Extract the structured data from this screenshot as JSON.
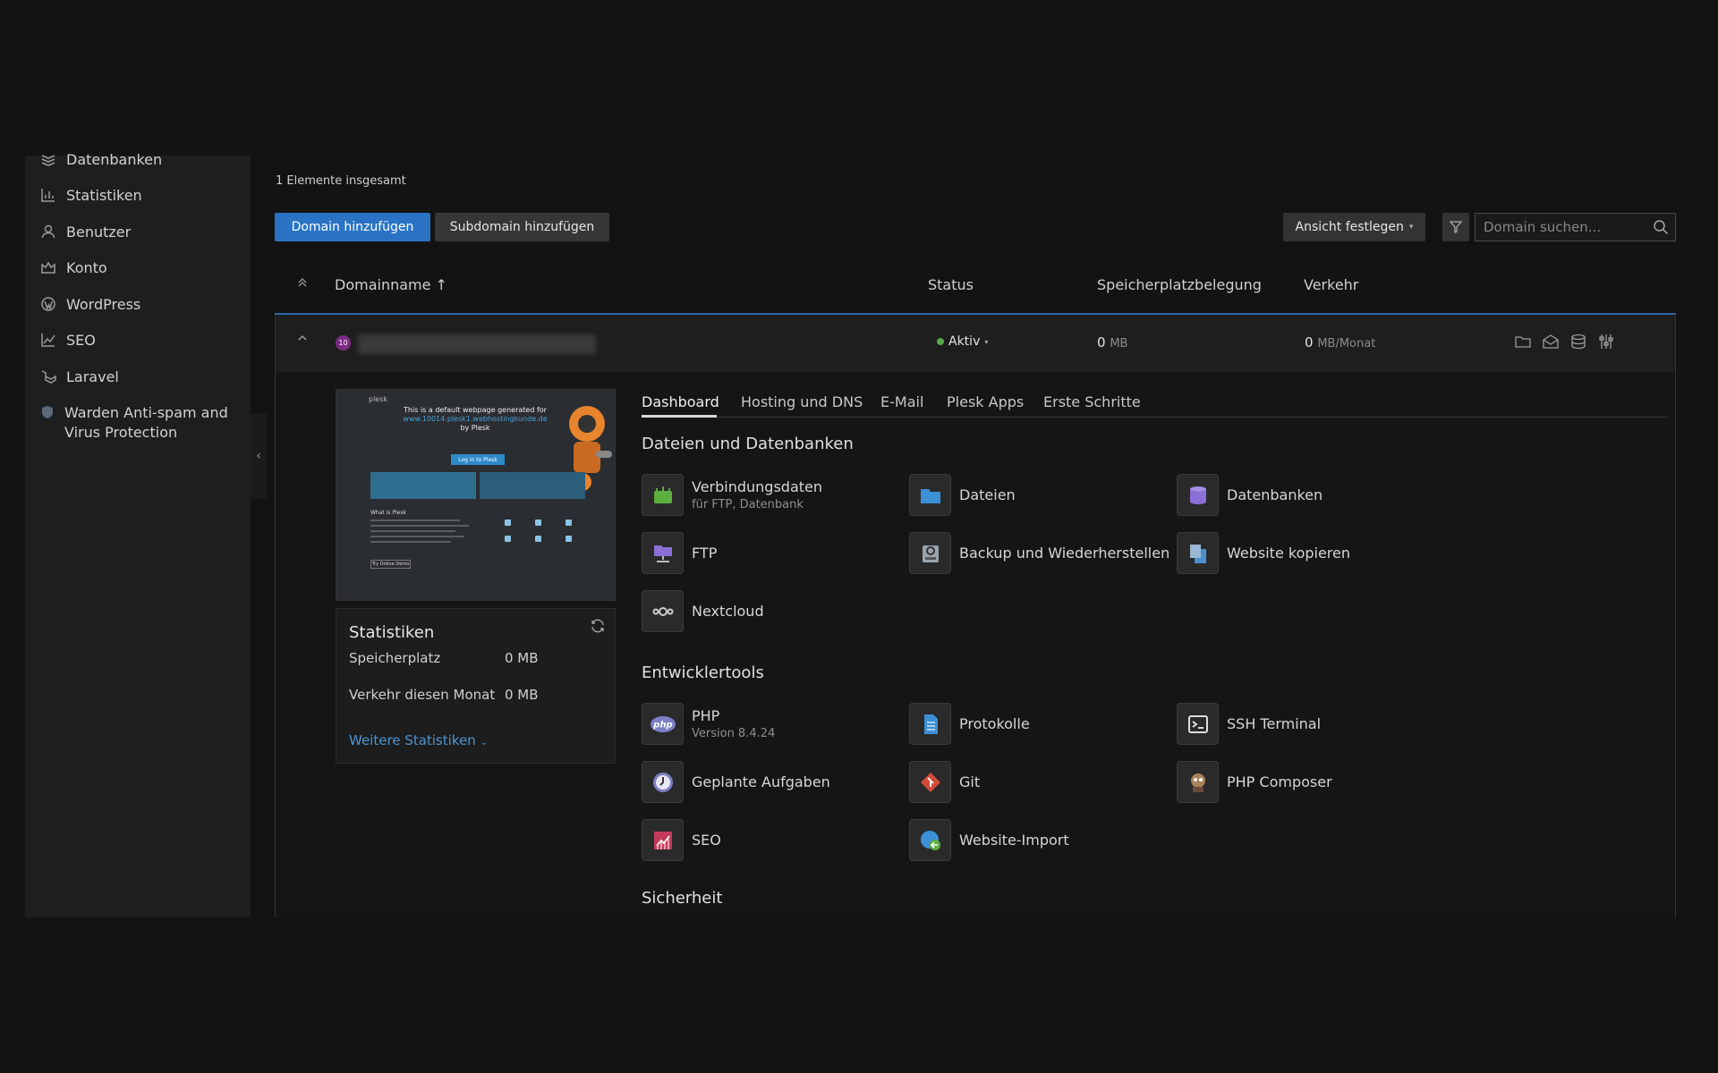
{
  "sidebar": {
    "items": [
      {
        "label": "Datenbanken",
        "icon": "database-icon"
      },
      {
        "label": "Statistiken",
        "icon": "bar-chart-icon"
      },
      {
        "label": "Benutzer",
        "icon": "user-icon"
      },
      {
        "label": "Konto",
        "icon": "crown-icon"
      },
      {
        "label": "WordPress",
        "icon": "wordpress-icon"
      },
      {
        "label": "SEO",
        "icon": "seo-icon"
      },
      {
        "label": "Laravel",
        "icon": "laravel-icon"
      },
      {
        "label": "Warden Anti-spam and Virus Protection",
        "icon": "shield-icon"
      }
    ]
  },
  "toolbar": {
    "total": "1 Elemente insgesamt",
    "add_domain": "Domain hinzufügen",
    "add_subdomain": "Subdomain hinzufügen",
    "view": "Ansicht festlegen",
    "search_placeholder": "Domain suchen..."
  },
  "table": {
    "headers": {
      "domain": "Domainname ↑",
      "status": "Status",
      "storage": "Speicherplatzbelegung",
      "traffic": "Verkehr"
    },
    "row": {
      "badge": "10",
      "status": "Aktiv",
      "storage_value": "0",
      "storage_unit": "MB",
      "traffic_value": "0",
      "traffic_unit": "MB/Monat"
    }
  },
  "preview": {
    "brand": "plesk",
    "title": "This is a default webpage generated for",
    "url": "www.10014.plesk1.webhostingkunde.de",
    "by": "by Plesk",
    "login": "Log in to Plesk",
    "what": "What is Plesk",
    "demo": "Try Online Demo"
  },
  "stats": {
    "title": "Statistiken",
    "storage_label": "Speicherplatz",
    "storage_value": "0 MB",
    "traffic_label": "Verkehr diesen Monat",
    "traffic_value": "0 MB",
    "more": "Weitere Statistiken"
  },
  "tabs": [
    "Dashboard",
    "Hosting und DNS",
    "E-Mail",
    "Plesk Apps",
    "Erste Schritte"
  ],
  "sections": {
    "files": {
      "title": "Dateien und Datenbanken",
      "tools": [
        {
          "name": "Verbindungsdaten",
          "sub": "für FTP, Datenbank",
          "icon": "connection-icon",
          "color": "#5cae3e"
        },
        {
          "name": "Dateien",
          "sub": "",
          "icon": "folder-icon",
          "color": "#3d8fd6"
        },
        {
          "name": "Datenbanken",
          "sub": "",
          "icon": "database-icon",
          "color": "#8a6fd6"
        },
        {
          "name": "FTP",
          "sub": "",
          "icon": "ftp-icon",
          "color": "#8a6fd6"
        },
        {
          "name": "Backup und Wiederherstellen",
          "sub": "",
          "icon": "backup-icon",
          "color": "#9aa4ad"
        },
        {
          "name": "Website kopieren",
          "sub": "",
          "icon": "copy-icon",
          "color": "#4b8fcf"
        },
        {
          "name": "Nextcloud",
          "sub": "",
          "icon": "nextcloud-icon",
          "color": "#8a8a8a"
        }
      ]
    },
    "dev": {
      "title": "Entwicklertools",
      "tools": [
        {
          "name": "PHP",
          "sub": "Version 8.4.24",
          "icon": "php-icon",
          "color": "#7b80c4"
        },
        {
          "name": "Protokolle",
          "sub": "",
          "icon": "logs-icon",
          "color": "#3d8fd6"
        },
        {
          "name": "SSH Terminal",
          "sub": "",
          "icon": "terminal-icon",
          "color": "#dddddd"
        },
        {
          "name": "Geplante Aufgaben",
          "sub": "",
          "icon": "clock-icon",
          "color": "#7b80c4"
        },
        {
          "name": "Git",
          "sub": "",
          "icon": "git-icon",
          "color": "#d34b3a"
        },
        {
          "name": "PHP Composer",
          "sub": "",
          "icon": "composer-icon",
          "color": "#a8835a"
        },
        {
          "name": "SEO",
          "sub": "",
          "icon": "seo-icon",
          "color": "#c43a5a"
        },
        {
          "name": "Website-Import",
          "sub": "",
          "icon": "import-icon",
          "color": "#3d8fd6"
        }
      ]
    },
    "security": {
      "title": "Sicherheit"
    }
  }
}
